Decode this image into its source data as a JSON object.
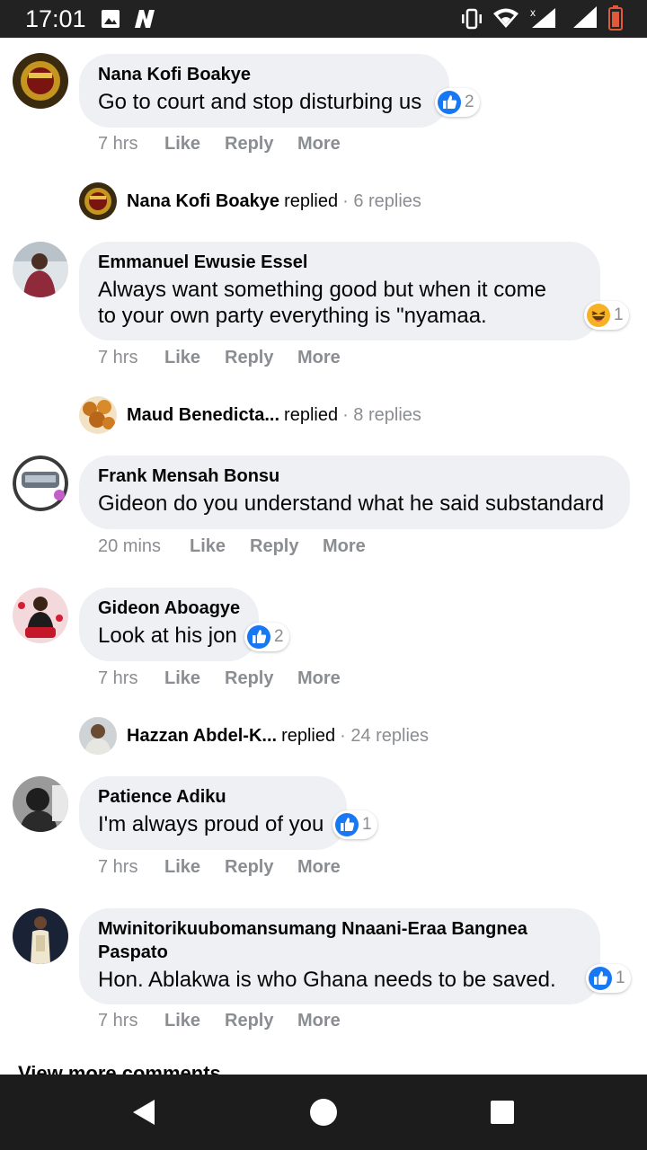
{
  "statusbar": {
    "time": "17:01",
    "icons": [
      "image-icon",
      "n-notification-icon",
      "vibrate-icon",
      "wifi-icon",
      "signal-x-icon",
      "signal-icon",
      "battery-low-icon"
    ]
  },
  "colors": {
    "bubble": "#eef0f3",
    "muted": "#8a8d91",
    "like_blue": "#1877f2",
    "haha_yellow": "#f7b125"
  },
  "comments": [
    {
      "name": "Nana Kofi Boakye",
      "text": "Go to court and stop disturbing us",
      "reaction": {
        "icon": "like-icon",
        "count": "2"
      },
      "time": "7 hrs",
      "like": "Like",
      "reply": "Reply",
      "more": "More",
      "replies": {
        "name": "Nana Kofi Boakye",
        "word": "replied",
        "count": "· 6 replies"
      }
    },
    {
      "name": "Emmanuel Ewusie Essel",
      "text_line1": "Always want something good but when it come",
      "text_line2": "to your own party everything is \"nyamaa.",
      "reaction": {
        "icon": "haha-icon",
        "count": "1"
      },
      "time": "7 hrs",
      "like": "Like",
      "reply": "Reply",
      "more": "More",
      "replies": {
        "name": "Maud Benedicta...",
        "word": "replied",
        "count": "· 8 replies"
      }
    },
    {
      "name": "Frank Mensah Bonsu",
      "text": "Gideon do you understand what he said substandard",
      "time": "20 mins",
      "like": "Like",
      "reply": "Reply",
      "more": "More"
    },
    {
      "name": "Gideon Aboagye",
      "text": "Look at his jon",
      "reaction": {
        "icon": "like-icon",
        "count": "2"
      },
      "time": "7 hrs",
      "like": "Like",
      "reply": "Reply",
      "more": "More",
      "replies": {
        "name": "Hazzan Abdel-K...",
        "word": "replied",
        "count": "· 24 replies"
      }
    },
    {
      "name": "Patience Adiku",
      "text": "I'm always proud of you",
      "reaction": {
        "icon": "like-icon",
        "count": "1"
      },
      "time": "7 hrs",
      "like": "Like",
      "reply": "Reply",
      "more": "More"
    },
    {
      "name_line1": "Mwinitorikuubomansumang Nnaani-Eraa Bangnea",
      "name_line2": "Paspato",
      "text": "Hon. Ablakwa is who Ghana needs to be saved.",
      "reaction": {
        "icon": "like-icon",
        "count": "1"
      },
      "time": "7 hrs",
      "like": "Like",
      "reply": "Reply",
      "more": "More"
    }
  ],
  "view_more": "View more comments",
  "navbar": {
    "buttons": [
      "back-icon",
      "home-icon",
      "recents-icon"
    ]
  }
}
